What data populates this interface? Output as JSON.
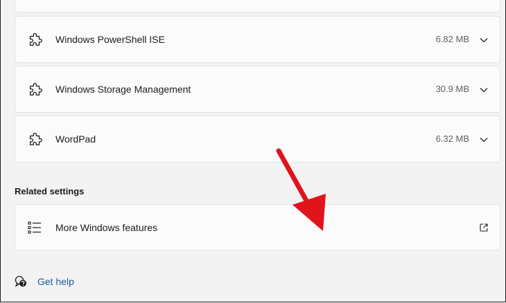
{
  "features": [
    {
      "name": "Windows PowerShell ISE",
      "size": "6.82 MB",
      "icon": "puzzle-icon"
    },
    {
      "name": "Windows Storage Management",
      "size": "30.9 MB",
      "icon": "puzzle-icon"
    },
    {
      "name": "WordPad",
      "size": "6.32 MB",
      "icon": "puzzle-icon"
    }
  ],
  "related": {
    "title": "Related settings",
    "item_label": "More Windows features",
    "item_icon": "list-icon",
    "action_icon": "external-link-icon"
  },
  "help": {
    "label": "Get help",
    "icon": "help-icon"
  },
  "colors": {
    "link": "#1c5a9e",
    "arrow": "#e0141b",
    "card": "#fbfbfb",
    "background": "#f3f3f3"
  }
}
